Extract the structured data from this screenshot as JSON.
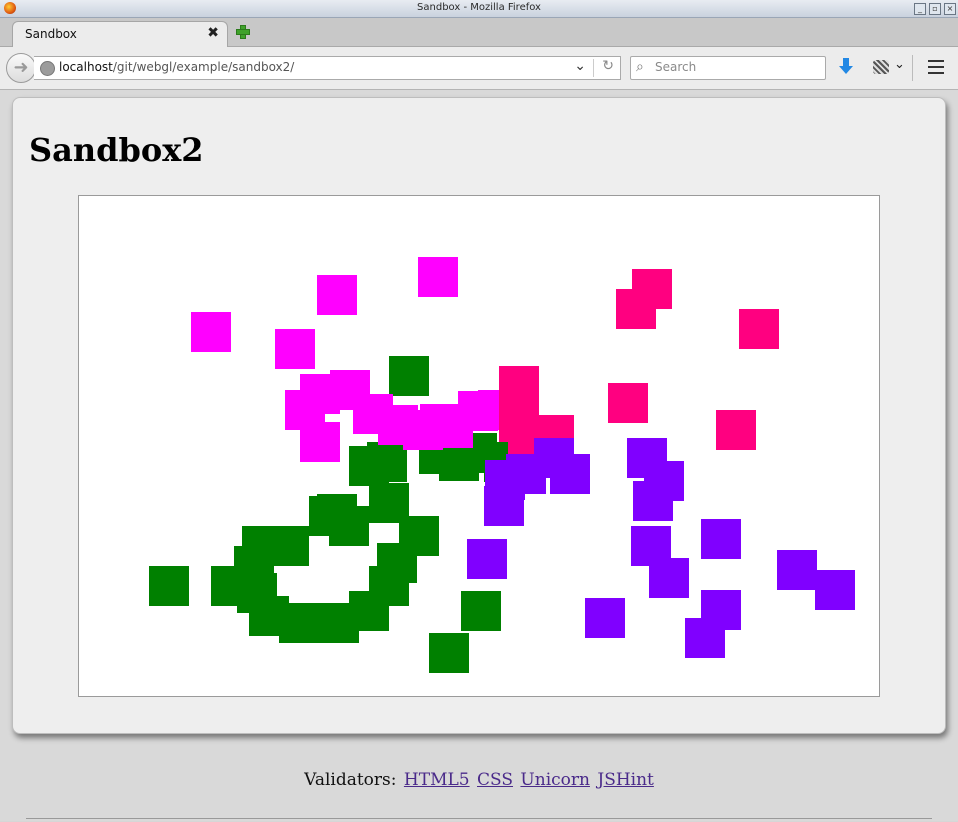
{
  "window": {
    "title": "Sandbox - Mozilla Firefox"
  },
  "tab": {
    "label": "Sandbox",
    "close_glyph": "✖"
  },
  "nav": {
    "url_host": "localhost",
    "url_path": "/git/webgl/example/sandbox2/",
    "search_placeholder": "Search"
  },
  "page": {
    "heading": "Sandbox2",
    "validators_label": "Validators:",
    "links": [
      "HTML5",
      "CSS",
      "Unicorn",
      "JSHint"
    ]
  },
  "colors": {
    "magenta": "#ff00ff",
    "pink": "#ff0080",
    "purple": "#8000ff",
    "green": "#008000"
  },
  "icons": [
    "firefox-icon",
    "new-tab-icon",
    "back-arrow-icon",
    "globe-icon",
    "dropdown-arrow-icon",
    "reload-icon",
    "search-icon",
    "download-icon",
    "extension-icon",
    "menu-icon"
  ]
}
